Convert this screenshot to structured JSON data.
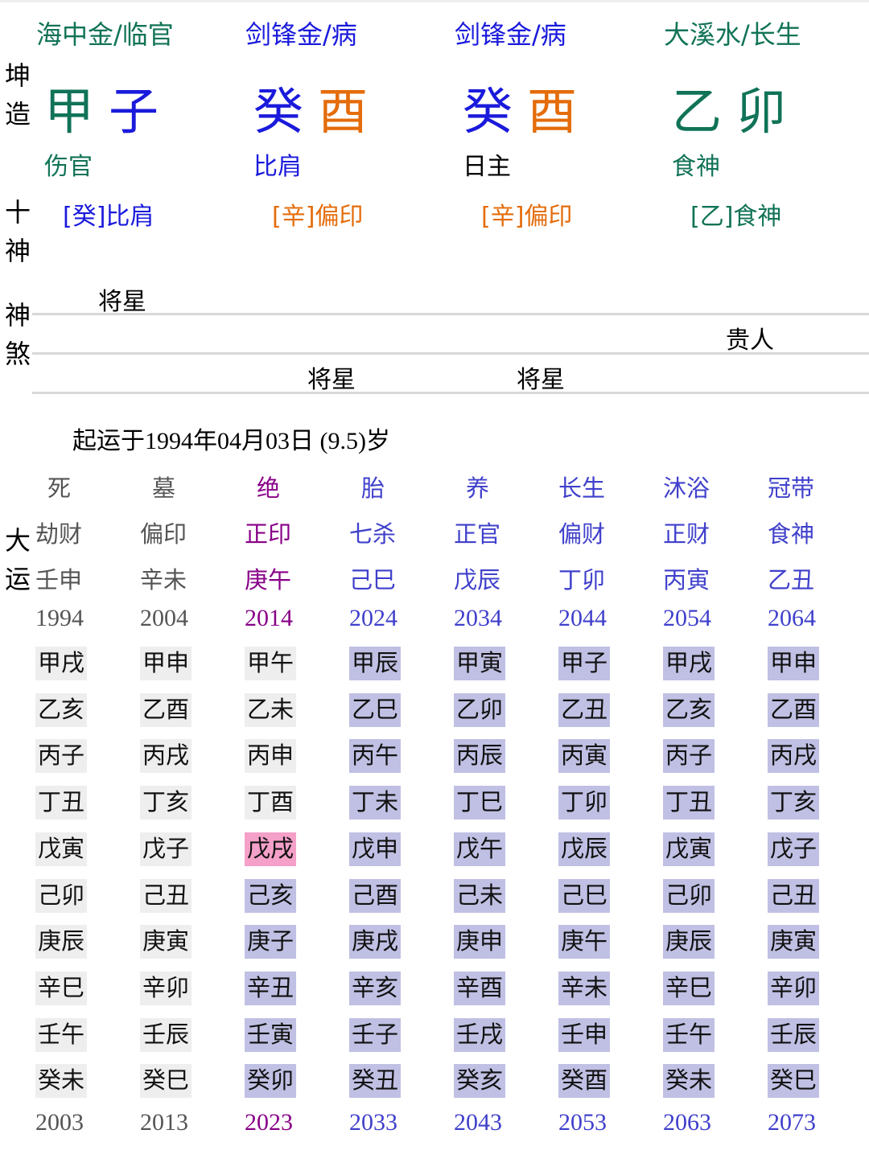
{
  "colors": {
    "wood": "#117357",
    "water": "#1a1adc",
    "metal": "#e46c0a",
    "past": "#555555",
    "current": "#880088",
    "future": "#4040cc",
    "past_bg": "#eeeeee",
    "future_bg": "#c0c0e4",
    "highlight_bg": "#f4a0c8"
  },
  "side_labels": {
    "kunzao": [
      "坤",
      "造"
    ],
    "shishen": [
      "十",
      "神"
    ],
    "shensha": [
      "神",
      "煞"
    ],
    "dayun": [
      "大",
      "运"
    ]
  },
  "pillars": [
    {
      "nayin": "海中金/临官",
      "stem": "甲",
      "branch": "子",
      "stem_color": "#117357",
      "branch_color": "#1a1adc",
      "nayin_color": "#117357",
      "shishen": "伤官",
      "shishen_color": "#117357",
      "canggan": "[癸]比肩",
      "canggan_color": "#1a1adc"
    },
    {
      "nayin": "剑锋金/病",
      "stem": "癸",
      "branch": "酉",
      "stem_color": "#1a1adc",
      "branch_color": "#e46c0a",
      "nayin_color": "#1a1adc",
      "shishen": "比肩",
      "shishen_color": "#1a1adc",
      "canggan": "[辛]偏印",
      "canggan_color": "#e46c0a"
    },
    {
      "nayin": "剑锋金/病",
      "stem": "癸",
      "branch": "酉",
      "stem_color": "#1a1adc",
      "branch_color": "#e46c0a",
      "nayin_color": "#1a1adc",
      "shishen": "日主",
      "shishen_color": "#000000",
      "canggan": "[辛]偏印",
      "canggan_color": "#e46c0a"
    },
    {
      "nayin": "大溪水/长生",
      "stem": "乙",
      "branch": "卯",
      "stem_color": "#117357",
      "branch_color": "#117357",
      "nayin_color": "#117357",
      "shishen": "食神",
      "shishen_color": "#117357",
      "canggan": "[乙]食神",
      "canggan_color": "#117357"
    }
  ],
  "shensha": {
    "row1": [
      "将星",
      "",
      "",
      ""
    ],
    "row2": [
      "",
      "",
      "",
      "贵人"
    ],
    "row3": [
      "",
      "将星",
      "将星",
      ""
    ]
  },
  "qiyun_text": "起运于1994年04月03日 (9.5)岁",
  "dayun": [
    {
      "status": "past",
      "changsheng": "死",
      "shishen": "劫财",
      "ganzhi": "壬申",
      "start": "1994",
      "end": "2003",
      "years": [
        "甲戌",
        "乙亥",
        "丙子",
        "丁丑",
        "戊寅",
        "己卯",
        "庚辰",
        "辛巳",
        "壬午",
        "癸未"
      ]
    },
    {
      "status": "past",
      "changsheng": "墓",
      "shishen": "偏印",
      "ganzhi": "辛未",
      "start": "2004",
      "end": "2013",
      "years": [
        "甲申",
        "乙酉",
        "丙戌",
        "丁亥",
        "戊子",
        "己丑",
        "庚寅",
        "辛卯",
        "壬辰",
        "癸巳"
      ]
    },
    {
      "status": "current",
      "changsheng": "绝",
      "shishen": "正印",
      "ganzhi": "庚午",
      "start": "2014",
      "end": "2023",
      "years": [
        "甲午",
        "乙未",
        "丙申",
        "丁酉",
        "戊戌",
        "己亥",
        "庚子",
        "辛丑",
        "壬寅",
        "癸卯"
      ],
      "highlight_index": 4,
      "future_from_index": 5
    },
    {
      "status": "future",
      "changsheng": "胎",
      "shishen": "七杀",
      "ganzhi": "己巳",
      "start": "2024",
      "end": "2033",
      "years": [
        "甲辰",
        "乙巳",
        "丙午",
        "丁未",
        "戊申",
        "己酉",
        "庚戌",
        "辛亥",
        "壬子",
        "癸丑"
      ]
    },
    {
      "status": "future",
      "changsheng": "养",
      "shishen": "正官",
      "ganzhi": "戊辰",
      "start": "2034",
      "end": "2043",
      "years": [
        "甲寅",
        "乙卯",
        "丙辰",
        "丁巳",
        "戊午",
        "己未",
        "庚申",
        "辛酉",
        "壬戌",
        "癸亥"
      ]
    },
    {
      "status": "future",
      "changsheng": "长生",
      "shishen": "偏财",
      "ganzhi": "丁卯",
      "start": "2044",
      "end": "2053",
      "years": [
        "甲子",
        "乙丑",
        "丙寅",
        "丁卯",
        "戊辰",
        "己巳",
        "庚午",
        "辛未",
        "壬申",
        "癸酉"
      ]
    },
    {
      "status": "future",
      "changsheng": "沐浴",
      "shishen": "正财",
      "ganzhi": "丙寅",
      "start": "2054",
      "end": "2063",
      "years": [
        "甲戌",
        "乙亥",
        "丙子",
        "丁丑",
        "戊寅",
        "己卯",
        "庚辰",
        "辛巳",
        "壬午",
        "癸未"
      ]
    },
    {
      "status": "future",
      "changsheng": "冠带",
      "shishen": "食神",
      "ganzhi": "乙丑",
      "start": "2064",
      "end": "2073",
      "years": [
        "甲申",
        "乙酉",
        "丙戌",
        "丁亥",
        "戊子",
        "己丑",
        "庚寅",
        "辛卯",
        "壬辰",
        "癸巳"
      ]
    }
  ]
}
